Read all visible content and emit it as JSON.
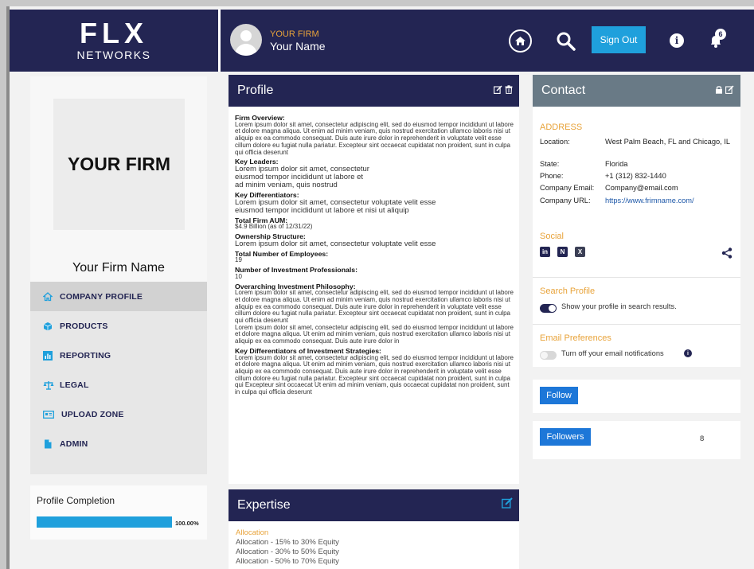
{
  "header": {
    "logo_top": "FLX",
    "logo_bottom": "NETWORKS",
    "firm_label": "YOUR FIRM",
    "user_name": "Your Name",
    "signout_label": "Sign Out",
    "notification_count": "6"
  },
  "sidebar": {
    "firm_logo_text": "YOUR FIRM",
    "firm_name": "Your Firm Name",
    "nav": [
      {
        "label": "COMPANY PROFILE",
        "icon": "home-icon",
        "active": true
      },
      {
        "label": "PRODUCTS",
        "icon": "cube-icon"
      },
      {
        "label": "REPORTING",
        "icon": "bar-chart-icon"
      },
      {
        "label": "LEGAL",
        "icon": "scale-icon"
      },
      {
        "label": "UPLOAD ZONE",
        "icon": "upload-icon"
      },
      {
        "label": "ADMIN",
        "icon": "document-icon"
      }
    ],
    "completion_title": "Profile Completion",
    "completion_value": "100.00%",
    "completion_fraction": 1.0
  },
  "profile": {
    "title": "Profile",
    "sections": [
      {
        "heading": "Firm Overview:",
        "text": "Lorem ipsum dolor sit amet, consectetur adipiscing elit, sed do eiusmod tempor incididunt ut labore et dolore magna aliqua. Ut enim ad minim veniam, quis nostrud exercitation ullamco laboris nisi ut aliquip ex ea commodo consequat. Duis aute irure dolor in reprehenderit in voluptate velit esse cillum dolore eu fugiat nulla pariatur. Excepteur sint occaecat cupidatat non proident, sunt in culpa qui officia deserunt"
      },
      {
        "heading": "Key Leaders:",
        "text": "Lorem ipsum dolor sit amet, consectetur\neiusmod tempor incididunt ut labore et\nad minim veniam, quis nostrud",
        "large": true
      },
      {
        "heading": "Key Differentiators:",
        "text": "Lorem ipsum dolor sit amet, consectetur voluptate velit esse\neiusmod tempor incididunt ut labore et nisi ut aliquip",
        "large": true
      },
      {
        "heading": "Total Firm AUM:",
        "text": "$4.9 Billion (as of 12/31/22)"
      },
      {
        "heading": "Ownership Structure:",
        "text": "Lorem ipsum dolor sit amet, consectetur voluptate velit esse",
        "large": true
      },
      {
        "heading": "Total Number of Employees:",
        "text": "19"
      },
      {
        "heading": "Number of Investment Professionals:",
        "text": "10"
      },
      {
        "heading": "Overarching Investment Philosophy:",
        "text": "Lorem ipsum dolor sit amet, consectetur adipiscing elit, sed do eiusmod tempor incididunt ut labore et dolore magna aliqua. Ut enim ad minim veniam, quis nostrud exercitation ullamco laboris nisi ut aliquip ex ea commodo consequat. Duis aute irure dolor in reprehenderit in voluptate velit esse cillum dolore eu fugiat nulla pariatur. Excepteur sint occaecat cupidatat non proident, sunt in culpa qui officia deserunt\nLorem ipsum dolor sit amet, consectetur adipiscing elit, sed do eiusmod tempor incididunt ut labore et dolore magna aliqua. Ut enim ad minim veniam, quis nostrud exercitation ullamco laboris nisi ut aliquip ex ea commodo consequat. Duis aute irure dolor in"
      },
      {
        "heading": "Key Differentiators of Investment Strategies:",
        "text": "Lorem ipsum dolor sit amet, consectetur adipiscing elit, sed do eiusmod tempor incididunt ut labore et dolore magna aliqua. Ut enim ad minim veniam, quis nostrud exercitation ullamco laboris nisi ut aliquip ex ea commodo consequat. Duis aute irure dolor in reprehenderit in voluptate velit esse cillum dolore eu fugiat nulla pariatur. Excepteur sint occaecat cupidatat non proident, sunt in culpa qui Excepteur sint occaecat Ut enim ad minim veniam, quis occaecat cupidatat non proident, sunt in culpa qui officia deserunt"
      }
    ]
  },
  "expertise": {
    "title": "Expertise",
    "subheading": "Allocation",
    "items": [
      "Allocation - 15% to 30% Equity",
      "Allocation - 30% to 50% Equity",
      "Allocation - 50% to 70% Equity"
    ]
  },
  "contact": {
    "title": "Contact",
    "address_heading": "ADDRESS",
    "rows": [
      {
        "label": "Location:",
        "value": "West Palm Beach, FL and Chicago, IL"
      },
      {
        "label": "State:",
        "value": "Florida"
      },
      {
        "label": "Phone:",
        "value": "+1 (312) 832-1440"
      },
      {
        "label": "Company Email:",
        "value": "Company@email.com"
      },
      {
        "label": "Company URL:",
        "value": "https://www.frimname.com/"
      }
    ],
    "social_heading": "Social",
    "search_heading": "Search Profile",
    "search_note": "Show your profile in search results.",
    "search_enabled": true,
    "email_heading": "Email Preferences",
    "email_note": "Turn off your email notifications",
    "email_enabled": false
  },
  "follow": {
    "follow_label": "Follow",
    "followers_label": "Followers",
    "followers_count": "8"
  },
  "colors": {
    "navy": "#232553",
    "accent_blue": "#1fa0dc",
    "button_blue": "#1d77d8",
    "orange": "#e8a33a",
    "contact_header": "#697a86"
  }
}
